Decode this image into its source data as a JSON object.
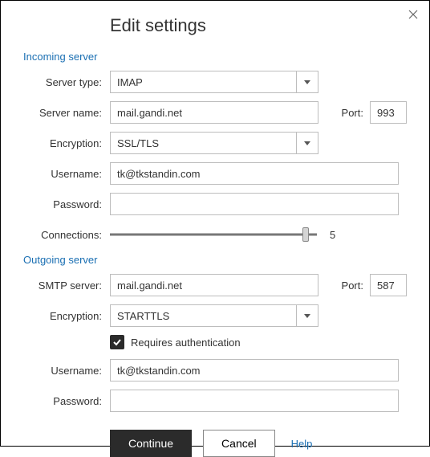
{
  "title": "Edit settings",
  "incoming_header": "Incoming server",
  "outgoing_header": "Outgoing server",
  "labels": {
    "server_type": "Server type:",
    "server_name": "Server name:",
    "encryption": "Encryption:",
    "username": "Username:",
    "password": "Password:",
    "connections": "Connections:",
    "smtp_server": "SMTP server:",
    "port": "Port:",
    "requires_auth": "Requires authentication"
  },
  "incoming": {
    "server_type": "IMAP",
    "server_name": "mail.gandi.net",
    "port": "993",
    "encryption": "SSL/TLS",
    "username": "tk@tkstandin.com",
    "password": "",
    "connections": "5"
  },
  "outgoing": {
    "smtp_server": "mail.gandi.net",
    "port": "587",
    "encryption": "STARTTLS",
    "requires_auth": true,
    "username": "tk@tkstandin.com",
    "password": ""
  },
  "buttons": {
    "continue": "Continue",
    "cancel": "Cancel",
    "help": "Help"
  }
}
